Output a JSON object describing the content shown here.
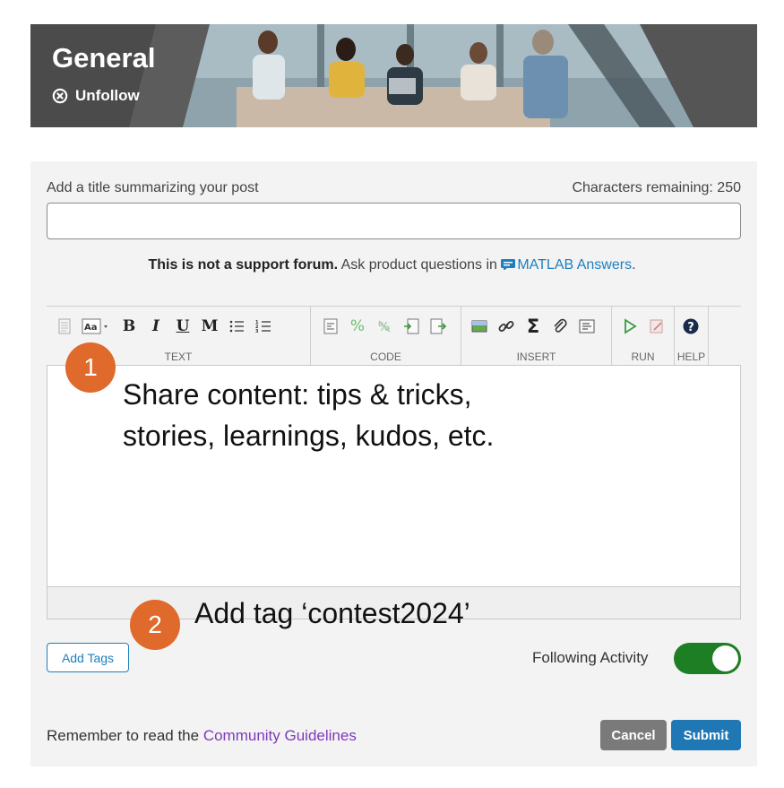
{
  "banner": {
    "title": "General",
    "unfollow_label": "Unfollow",
    "unfollow_icon": "circle-x-icon"
  },
  "form": {
    "title_label": "Add a title summarizing your post",
    "char_remaining": "Characters remaining: 250",
    "title_value": "",
    "notice_bold": "This is not a support forum.",
    "notice_text": " Ask product questions in ",
    "matlab_link": "MATLAB Answers",
    "notice_end": "."
  },
  "toolbar": {
    "groups": [
      {
        "label": "TEXT"
      },
      {
        "label": "CODE"
      },
      {
        "label": "INSERT"
      },
      {
        "label": "RUN"
      },
      {
        "label": "HELP"
      }
    ],
    "text_buttons": {
      "bold": "B",
      "italic": "I",
      "underline": "U",
      "monospace": "M"
    }
  },
  "callouts": [
    {
      "number": "1",
      "text_line1": "Share content: tips & tricks,",
      "text_line2": "stories, learnings, kudos, etc."
    },
    {
      "number": "2",
      "text_line1": "Add tag ‘contest2024’"
    }
  ],
  "footer": {
    "add_tags": "Add Tags",
    "following_label": "Following Activity",
    "following_on": true,
    "guidelines_prefix": "Remember to read the ",
    "guidelines_link": "Community Guidelines",
    "cancel": "Cancel",
    "submit": "Submit"
  },
  "colors": {
    "accent": "#1f7fbd",
    "callout": "#e06a2b",
    "toggle_on": "#1e7e24",
    "link_purple": "#7d3bb8"
  }
}
